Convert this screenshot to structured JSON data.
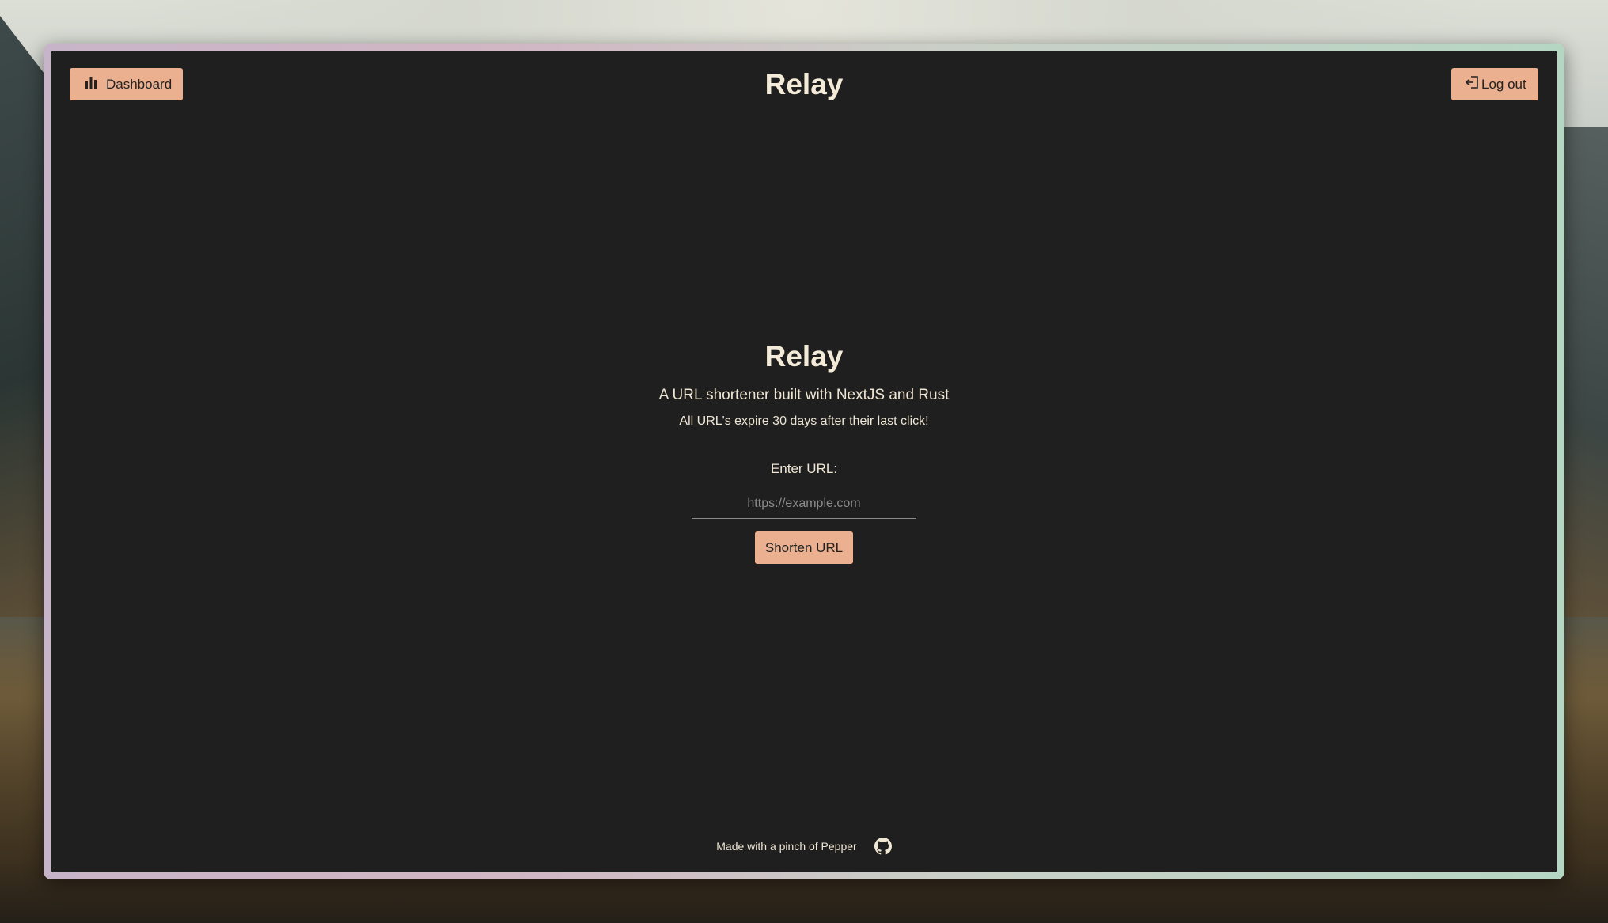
{
  "app": {
    "title": "Relay"
  },
  "header": {
    "dashboard_label": "Dashboard",
    "dashboard_icon": "bar-chart-icon",
    "logout_label": "Log out",
    "logout_icon": "logout-icon"
  },
  "hero": {
    "title": "Relay",
    "subtitle": "A URL shortener built with NextJS and Rust",
    "note": "All URL's expire 30 days after their last click!"
  },
  "form": {
    "label": "Enter URL:",
    "value": "",
    "placeholder": "https://example.com",
    "submit_label": "Shorten URL"
  },
  "footer": {
    "text": "Made with a pinch of Pepper",
    "icon": "github-icon"
  },
  "colors": {
    "background": "#1f1f1f",
    "accent": "#ebb08f",
    "text": "#f4ead8"
  }
}
